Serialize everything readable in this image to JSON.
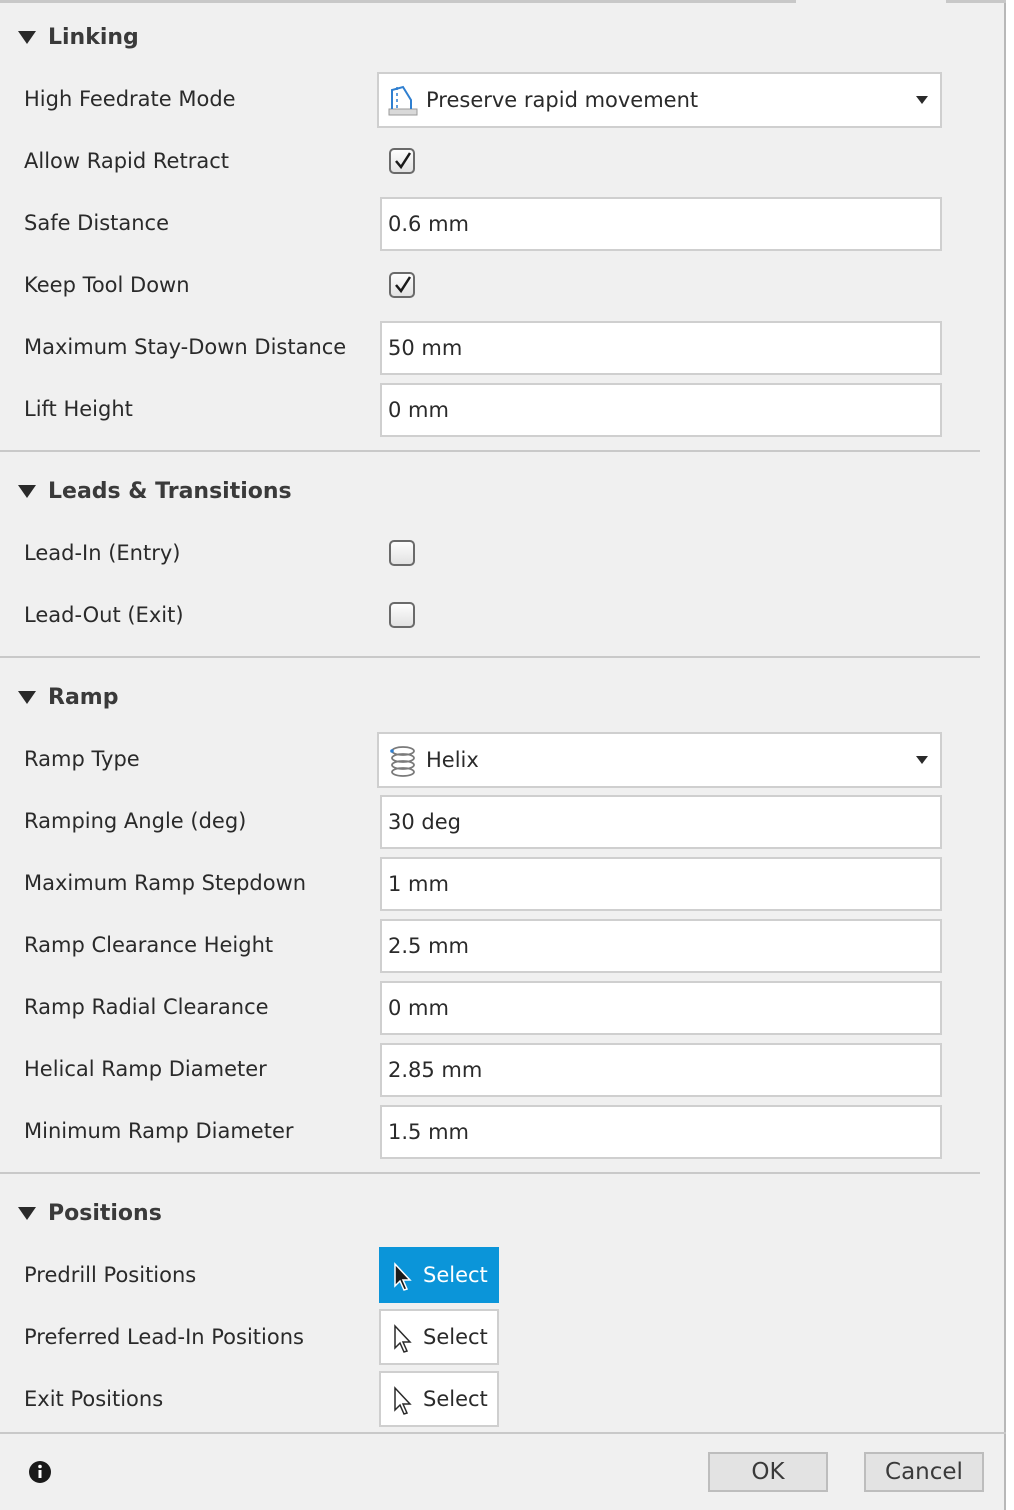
{
  "sections": {
    "linking": {
      "title": "Linking",
      "high_feedrate_mode": {
        "label": "High Feedrate Mode",
        "value": "Preserve rapid movement",
        "icon": "rapid-movement-icon"
      },
      "allow_rapid_retract": {
        "label": "Allow Rapid Retract",
        "checked": true
      },
      "safe_distance": {
        "label": "Safe Distance",
        "value": "0.6 mm"
      },
      "keep_tool_down": {
        "label": "Keep Tool Down",
        "checked": true
      },
      "max_stay_down": {
        "label": "Maximum Stay-Down Distance",
        "value": "50 mm"
      },
      "lift_height": {
        "label": "Lift Height",
        "value": "0 mm"
      }
    },
    "leads": {
      "title": "Leads & Transitions",
      "lead_in": {
        "label": "Lead-In (Entry)",
        "checked": false
      },
      "lead_out": {
        "label": "Lead-Out (Exit)",
        "checked": false
      }
    },
    "ramp": {
      "title": "Ramp",
      "ramp_type": {
        "label": "Ramp Type",
        "value": "Helix",
        "icon": "helix-icon"
      },
      "ramping_angle": {
        "label": "Ramping Angle (deg)",
        "value": "30 deg"
      },
      "max_ramp_stepdown": {
        "label": "Maximum Ramp Stepdown",
        "value": "1 mm"
      },
      "ramp_clearance_height": {
        "label": "Ramp Clearance Height",
        "value": "2.5 mm"
      },
      "ramp_radial_clearance": {
        "label": "Ramp Radial Clearance",
        "value": "0 mm"
      },
      "helical_ramp_diameter": {
        "label": "Helical Ramp Diameter",
        "value": "2.85 mm"
      },
      "min_ramp_diameter": {
        "label": "Minimum Ramp Diameter",
        "value": "1.5 mm"
      }
    },
    "positions": {
      "title": "Positions",
      "predrill": {
        "label": "Predrill Positions",
        "button": "Select",
        "active": true
      },
      "preferred_lead_in": {
        "label": "Preferred Lead-In Positions",
        "button": "Select",
        "active": false
      },
      "exit": {
        "label": "Exit Positions",
        "button": "Select",
        "active": false
      }
    }
  },
  "footer": {
    "ok_label": "OK",
    "cancel_label": "Cancel",
    "info_icon": "info-icon"
  },
  "colors": {
    "accent": "#0b95d9",
    "panel_bg": "#f0f0f0"
  }
}
